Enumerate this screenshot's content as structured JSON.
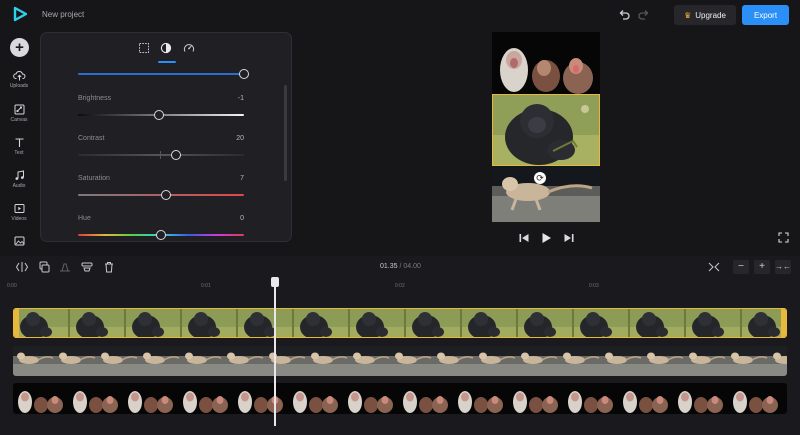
{
  "header": {
    "project_title": "New project",
    "upgrade_label": "Upgrade",
    "export_label": "Export"
  },
  "leftbar": {
    "items": [
      {
        "label": "Uploads",
        "icon": "upload-icon"
      },
      {
        "label": "Canvas",
        "icon": "canvas-icon"
      },
      {
        "label": "Text",
        "icon": "text-icon"
      },
      {
        "label": "Audio",
        "icon": "audio-icon"
      },
      {
        "label": "Videos",
        "icon": "videos-icon"
      },
      {
        "label": "",
        "icon": "images-icon"
      }
    ]
  },
  "panel": {
    "tabs": [
      {
        "name": "crop-icon"
      },
      {
        "name": "adjust-icon",
        "active": true
      },
      {
        "name": "speed-icon"
      }
    ],
    "sliders": [
      {
        "label": "",
        "value": "",
        "fraction": 1.0
      },
      {
        "label": "Brightness",
        "value": "-1",
        "fraction": 0.49
      },
      {
        "label": "Contrast",
        "value": "20",
        "fraction": 0.59
      },
      {
        "label": "Saturation",
        "value": "7",
        "fraction": 0.53
      },
      {
        "label": "Hue",
        "value": "0",
        "fraction": 0.5
      }
    ]
  },
  "timeline": {
    "current_time": "01.35",
    "separator": "/",
    "total_time": "04.00",
    "ruler_labels": [
      "0:00",
      "0:01",
      "0:02",
      "0:03"
    ],
    "playhead_fraction": 0.34
  },
  "colors": {
    "accent": "#2a8ff7",
    "selection": "#e8b83a",
    "background": "#161619",
    "panel": "#1f1f24"
  }
}
